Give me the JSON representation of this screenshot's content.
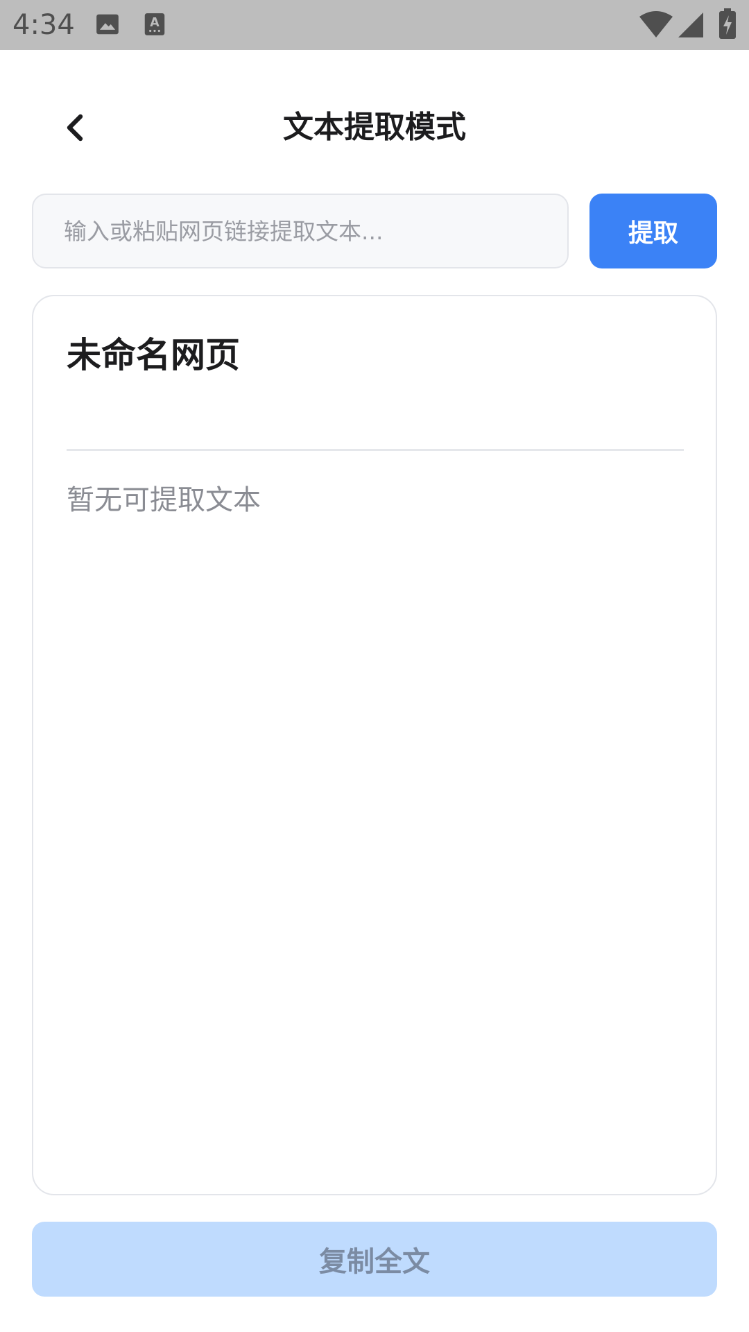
{
  "status_bar": {
    "time": "4:34",
    "icons": [
      "image-icon",
      "keyboard-a-icon",
      "wifi-icon",
      "signal-icon",
      "battery-charging-icon"
    ]
  },
  "header": {
    "title": "文本提取模式",
    "back_icon": "chevron-left-icon"
  },
  "search": {
    "placeholder": "输入或粘贴网页链接提取文本...",
    "value": "",
    "button_label": "提取"
  },
  "result": {
    "title": "未命名网页",
    "empty_text": "暂无可提取文本"
  },
  "footer": {
    "copy_label": "复制全文"
  },
  "colors": {
    "accent": "#3b82f6",
    "accent_disabled": "#bfdbfe",
    "status_bar": "#bdbdbd"
  }
}
